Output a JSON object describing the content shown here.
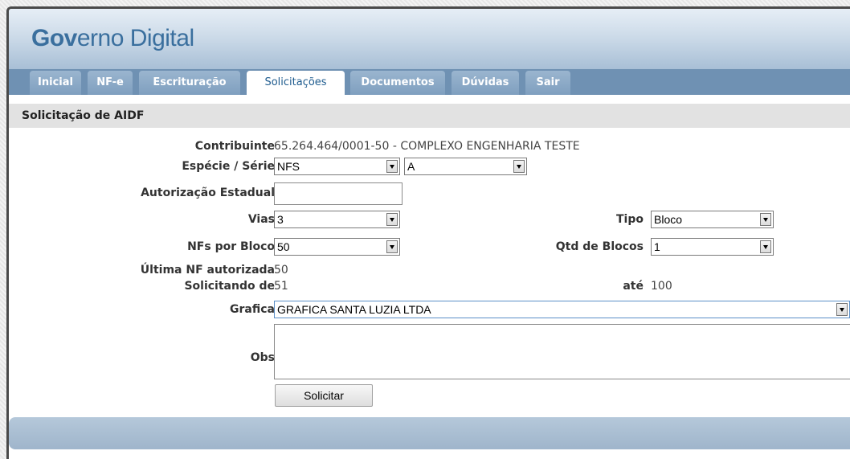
{
  "app": {
    "brand_bold": "Gov",
    "brand_rest": "erno Digital"
  },
  "tabs": [
    {
      "label": "Inicial"
    },
    {
      "label": "NF-e"
    },
    {
      "label": "Escrituração"
    },
    {
      "label": "Solicitações",
      "active": true
    },
    {
      "label": "Documentos"
    },
    {
      "label": "Dúvidas"
    },
    {
      "label": "Sair"
    }
  ],
  "section_title": "Solicitação de AIDF",
  "form": {
    "contribuinte_label": "Contribuinte",
    "contribuinte_value": "65.264.464/0001-50 - COMPLEXO ENGENHARIA TESTE",
    "especie_label": "Espécie / Série",
    "especie_value": "NFS",
    "serie_value": "A",
    "autorizacao_label": "Autorização Estadual",
    "autorizacao_value": "",
    "vias_label": "Vias",
    "vias_value": "3",
    "tipo_label": "Tipo",
    "tipo_value": "Bloco",
    "nfs_bloco_label": "NFs por Bloco",
    "nfs_bloco_value": "50",
    "qtd_blocos_label": "Qtd de Blocos",
    "qtd_blocos_value": "1",
    "ultima_nf_label": "Última NF autorizada",
    "ultima_nf_value": "50",
    "solicitando_label": "Solicitando de",
    "solicitando_value": "51",
    "ate_label": "até",
    "ate_value": "100",
    "grafica_label": "Grafica",
    "grafica_value": "GRAFICA SANTA LUZIA LTDA",
    "obs_label": "Obs",
    "obs_value": "",
    "submit_label": "Solicitar"
  },
  "colors": {
    "brand": "#3a6f9e",
    "tabbar": "#6f91b3",
    "tab": "#8aa9c8",
    "footer": "#a8bdd2"
  }
}
